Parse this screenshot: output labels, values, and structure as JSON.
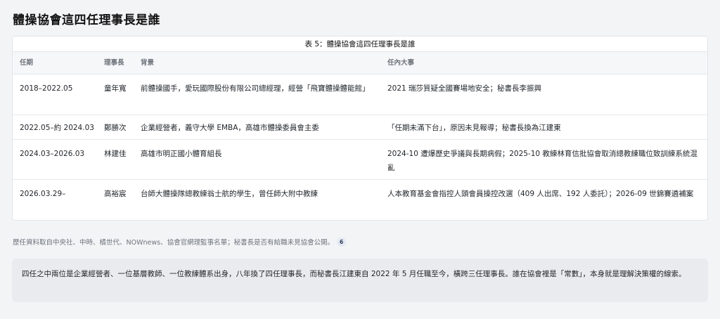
{
  "heading": "體操協會這四任理事長是誰",
  "table": {
    "caption": "表 5：體操協會這四任理事長是誰",
    "headers": [
      "任期",
      "理事長",
      "背景",
      "任內大事"
    ],
    "rows": [
      {
        "term": "2018–2022.05",
        "chair": "童年寬",
        "background": "前體操國手，愛玩國際股份有限公司總經理，經營「飛寶體操體能館」",
        "events": "2021 瑞莎質疑全國賽場地安全；秘書長李振興"
      },
      {
        "term": "2022.05–約 2024.03",
        "chair": "鄭勝次",
        "background": "企業經營者，義守大學 EMBA，高雄市體操委員會主委",
        "events": "「任期未滿下台」，原因未見報導；秘書長換為江建東"
      },
      {
        "term": "2024.03–2026.03",
        "chair": "林建佳",
        "background": "高雄市明正國小體育組長",
        "events": "2024-10 遭爆歷史爭議與長期病假；2025-10 教練林育信批協會取消總教練職位致訓練系統混亂"
      },
      {
        "term": "2026.03.29–",
        "chair": "高裕宸",
        "background": "台師大體操隊總教練翁士航的學生，曾任師大附中教練",
        "events": "人本教育基金會指控人頭會員操控改選（409 人出席、192 人委託）；2026-09 世錦賽遴補案"
      }
    ]
  },
  "source": {
    "text": "歷任資料取自中央社、中時、橘世代、NOWnews、協會官網理監事名單；秘書長是否有給職未見協會公開。",
    "footnote": "6"
  },
  "note": "四任之中兩位是企業經營者、一位基層教師、一位教練體系出身，八年換了四任理事長，而秘書長江建東自 2022 年 5 月任職至今，橫跨三任理事長。誰在協會裡是「常數」，本身就是理解決策權的線索。"
}
